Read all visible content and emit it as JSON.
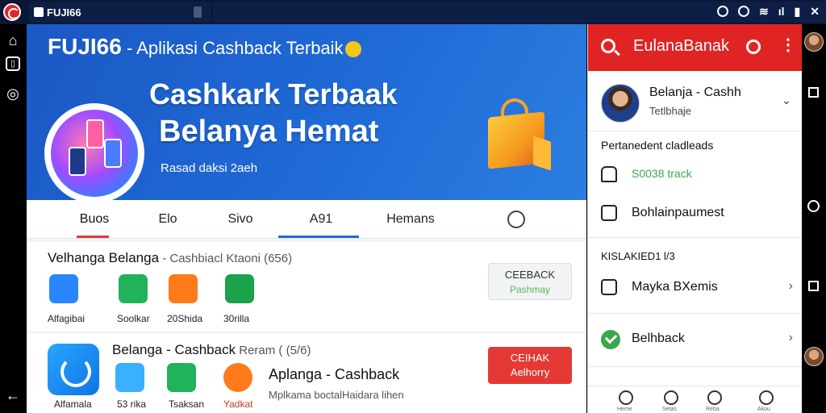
{
  "statusbar": {
    "title": "FUJI66"
  },
  "hero": {
    "title_brand": "FUJI66",
    "title_rest": " - Aplikasi Cashback Terbaik",
    "headline1": "Cashkark Terbaak",
    "headline2": "Belanya Hemat",
    "subtitle": "Rasad daksi 2aeh"
  },
  "tabs": [
    {
      "label": "Buos"
    },
    {
      "label": "Elo"
    },
    {
      "label": "Sivo"
    },
    {
      "label": "A91"
    },
    {
      "label": "Hemans"
    }
  ],
  "card1": {
    "title_main": "Velhanga  Belanga",
    "title_muted": " - Cashbiacl Ktaoni (656)",
    "apps": [
      {
        "label": "Alfagibai",
        "icon_color": "#2a86ff"
      },
      {
        "label": "Soolkar",
        "icon_color": "#20b35a"
      },
      {
        "label": "20Shida",
        "icon_color": "#ff7a1a"
      },
      {
        "label": "30rilla",
        "icon_color": "#1aa34a"
      }
    ],
    "button_title": "CEEBACK",
    "button_sub": "Pashmay"
  },
  "card2": {
    "title_main": "Belanga - Cashback",
    "title_muted": " Reram ( (5/6)",
    "apps": [
      {
        "label": "Alfamala",
        "icon_color": "#2a86ff"
      },
      {
        "label": "53 rika",
        "icon_color": "#3ab0ff"
      },
      {
        "label": "Tsaksan",
        "icon_color": "#20b35a"
      },
      {
        "label": "Yadkat",
        "icon_color": "#ff7a1a"
      }
    ],
    "item_title": "Aplanga - Cashback",
    "item_desc": "Mplkama boctalHaidara lihen",
    "button_title": "CEIHAK",
    "button_sub": "Aelhorry"
  },
  "drawer": {
    "title": "EulanaBanak",
    "profile_name": "Belanja - Cashh",
    "profile_sub": "Tetlbhaje",
    "section1": "Pertanedent cladleads",
    "items1": [
      {
        "label": "S0038 track",
        "style": "green"
      },
      {
        "label": "Bohlainpaumest",
        "style": "normal"
      }
    ],
    "section2": "KISLAKIED1 l/3",
    "items2": [
      {
        "label": "Mayka BXemis"
      },
      {
        "label": "Belhback"
      }
    ],
    "bottom_nav": [
      {
        "label": "Heme"
      },
      {
        "label": "Setas"
      },
      {
        "label": "Reba"
      },
      {
        "label": "Akou"
      }
    ]
  },
  "colors": {
    "accent_red": "#e02424",
    "hero_blue": "#1f6ad6",
    "green": "#3aa84a"
  }
}
